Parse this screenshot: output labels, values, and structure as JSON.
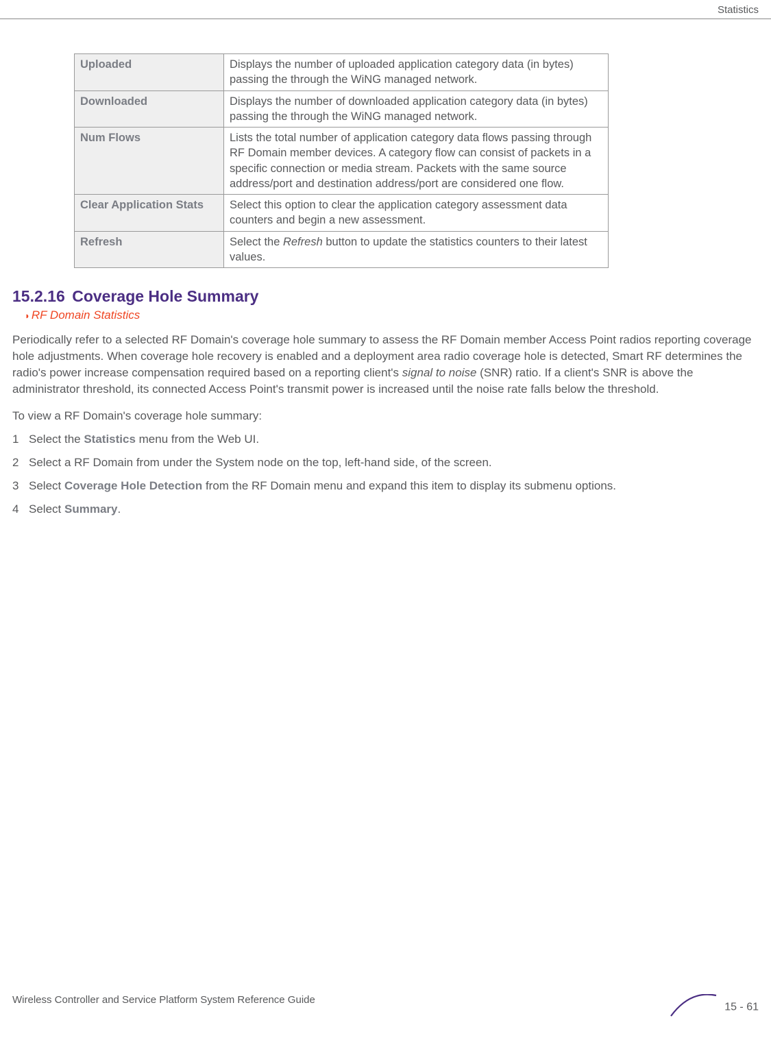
{
  "header": {
    "title": "Statistics"
  },
  "table": {
    "rows": [
      {
        "term": "Uploaded",
        "def": "Displays the number of uploaded application category data (in bytes) passing the through the WiNG managed network."
      },
      {
        "term": "Downloaded",
        "def": "Displays the number of downloaded application category data (in bytes) passing the through the WiNG managed network."
      },
      {
        "term": "Num Flows",
        "def": "Lists the total number of application category data flows passing through RF Domain member devices. A category flow can consist of packets in a specific connection or media stream. Packets with the same source address/port and destination address/port are considered one flow."
      },
      {
        "term": "Clear Application Stats",
        "def": "Select this option to clear the application category assessment data counters and begin a new assessment."
      },
      {
        "term": "Refresh",
        "def_pre": "Select the ",
        "def_italic": "Refresh",
        "def_post": " button to update the statistics counters to their latest values."
      }
    ]
  },
  "section": {
    "number": "15.2.16",
    "title": "Coverage Hole Summary",
    "breadcrumb": "RF Domain Statistics"
  },
  "paragraphs": {
    "intro_pre": "Periodically refer to a selected RF Domain's coverage hole summary to assess the RF Domain member Access Point radios reporting coverage hole adjustments. When coverage hole recovery is enabled and a deployment area radio coverage hole is detected, Smart RF determines the radio's power increase compensation required based on a reporting client's ",
    "intro_italic": "signal to noise",
    "intro_post": " (SNR) ratio. If a client's SNR is above the administrator threshold, its connected Access Point's transmit power is increased until the noise rate falls below the threshold.",
    "lead": "To view a RF Domain's coverage hole summary:"
  },
  "steps": [
    {
      "n": "1",
      "pre": "Select the ",
      "term": "Statistics",
      "post": " menu from the Web UI."
    },
    {
      "n": "2",
      "pre": "Select a RF Domain from under the System node on the top, left-hand side, of the screen.",
      "term": "",
      "post": ""
    },
    {
      "n": "3",
      "pre": "Select ",
      "term": "Coverage Hole Detection",
      "post": " from the RF Domain menu and expand this item to display its submenu options."
    },
    {
      "n": "4",
      "pre": "Select ",
      "term": "Summary",
      "post": "."
    }
  ],
  "footer": {
    "left": "Wireless Controller and Service Platform System Reference Guide",
    "page": "15 - 61"
  }
}
